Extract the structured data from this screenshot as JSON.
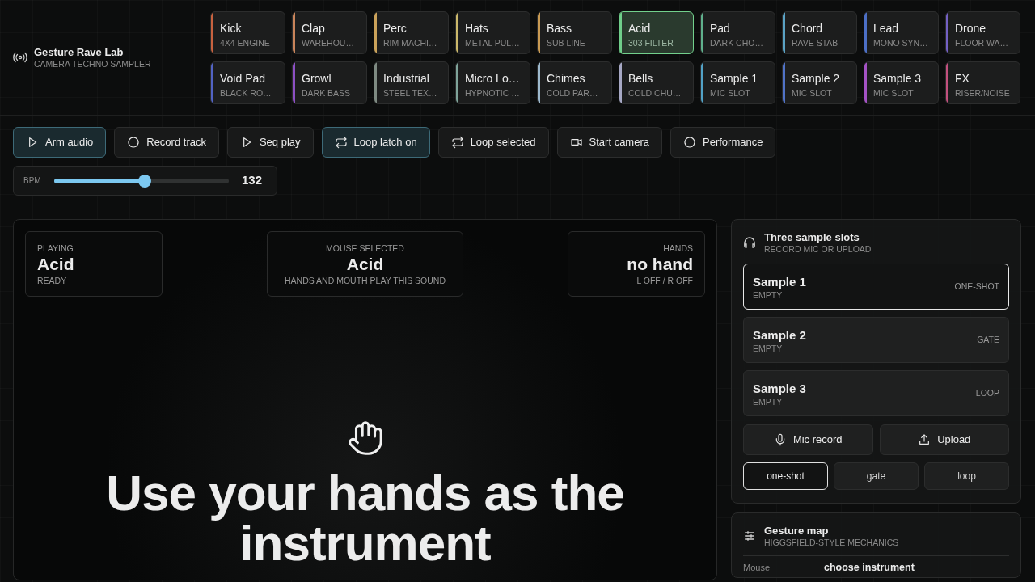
{
  "app": {
    "title": "Gesture Rave Lab",
    "subtitle": "CAMERA TECHNO SAMPLER"
  },
  "instruments": [
    {
      "name": "Kick",
      "sub": "4X4 ENGINE",
      "color": "#c8623f",
      "selected": false
    },
    {
      "name": "Clap",
      "sub": "WAREHOU…",
      "color": "#c9845a",
      "selected": false
    },
    {
      "name": "Perc",
      "sub": "RIM MACHI…",
      "color": "#caa25a",
      "selected": false
    },
    {
      "name": "Hats",
      "sub": "METAL PUL…",
      "color": "#cbb86a",
      "selected": false
    },
    {
      "name": "Bass",
      "sub": "SUB LINE",
      "color": "#c99a52",
      "selected": false
    },
    {
      "name": "Acid",
      "sub": "303 FILTER",
      "color": "#6fce8a",
      "selected": true
    },
    {
      "name": "Pad",
      "sub": "DARK CHO…",
      "color": "#5fb08c",
      "selected": false
    },
    {
      "name": "Chord",
      "sub": "RAVE STAB",
      "color": "#5aa2c4",
      "selected": false
    },
    {
      "name": "Lead",
      "sub": "MONO SYN…",
      "color": "#4c6fc6",
      "selected": false
    },
    {
      "name": "Drone",
      "sub": "FLOOR WA…",
      "color": "#7360c4",
      "selected": false
    },
    {
      "name": "Void Pad",
      "sub": "BLACK RO…",
      "color": "#5263c4",
      "selected": false
    },
    {
      "name": "Growl",
      "sub": "DARK BASS",
      "color": "#8c50c4",
      "selected": false
    },
    {
      "name": "Industrial",
      "sub": "STEEL TEX…",
      "color": "#7e8a82",
      "selected": false
    },
    {
      "name": "Micro Lo…",
      "sub": "HYPNOTIC …",
      "color": "#7fa49a",
      "selected": false
    },
    {
      "name": "Chimes",
      "sub": "COLD PAR…",
      "color": "#9cb8cc",
      "selected": false
    },
    {
      "name": "Bells",
      "sub": "COLD CHU…",
      "color": "#a6a8c4",
      "selected": false
    },
    {
      "name": "Sample 1",
      "sub": "MIC SLOT",
      "color": "#52a2c6",
      "selected": false
    },
    {
      "name": "Sample 2",
      "sub": "MIC SLOT",
      "color": "#5072c6",
      "selected": false
    },
    {
      "name": "Sample 3",
      "sub": "MIC SLOT",
      "color": "#a452c4",
      "selected": false
    },
    {
      "name": "FX",
      "sub": "RISER/NOISE",
      "color": "#c2507e",
      "selected": false
    }
  ],
  "toolbar": [
    {
      "label": "Arm audio",
      "kind": "play",
      "on": true
    },
    {
      "label": "Record track",
      "kind": "record",
      "on": false
    },
    {
      "label": "Seq play",
      "kind": "play",
      "on": false
    },
    {
      "label": "Loop latch on",
      "kind": "loop",
      "on": true
    },
    {
      "label": "Loop selected",
      "kind": "loop",
      "on": false
    },
    {
      "label": "Start camera",
      "kind": "camera",
      "on": false
    },
    {
      "label": "Performance",
      "kind": "record",
      "on": false
    }
  ],
  "bpm": {
    "label": "BPM",
    "level": 0.52,
    "value": "132"
  },
  "status": [
    {
      "label": "PLAYING",
      "value": "Acid",
      "note": "READY"
    },
    {
      "label": "MOUSE SELECTED",
      "value": "Acid",
      "note": "HANDS AND MOUTH PLAY THIS SOUND"
    },
    {
      "label": "HANDS",
      "value": "no hand",
      "note": "L OFF / R OFF"
    }
  ],
  "stage": {
    "headline": "Use your hands as the instrument"
  },
  "samples": {
    "title": "Three sample slots",
    "subtitle": "RECORD MIC OR UPLOAD",
    "slots": [
      {
        "name": "Sample 1",
        "state": "EMPTY",
        "mode": "ONE-SHOT",
        "selected": true
      },
      {
        "name": "Sample 2",
        "state": "EMPTY",
        "mode": "GATE",
        "selected": false
      },
      {
        "name": "Sample 3",
        "state": "EMPTY",
        "mode": "LOOP",
        "selected": false
      }
    ],
    "actions": [
      {
        "label": "Mic record",
        "kind": "mic"
      },
      {
        "label": "Upload",
        "kind": "upload"
      }
    ],
    "modes": [
      {
        "label": "one-shot",
        "selected": true
      },
      {
        "label": "gate",
        "selected": false
      },
      {
        "label": "loop",
        "selected": false
      }
    ]
  },
  "gesture_map": {
    "title": "Gesture map",
    "subtitle": "HIGGSFIELD-STYLE MECHANICS",
    "rows": [
      {
        "input": "Mouse",
        "action": "choose instrument"
      }
    ]
  }
}
